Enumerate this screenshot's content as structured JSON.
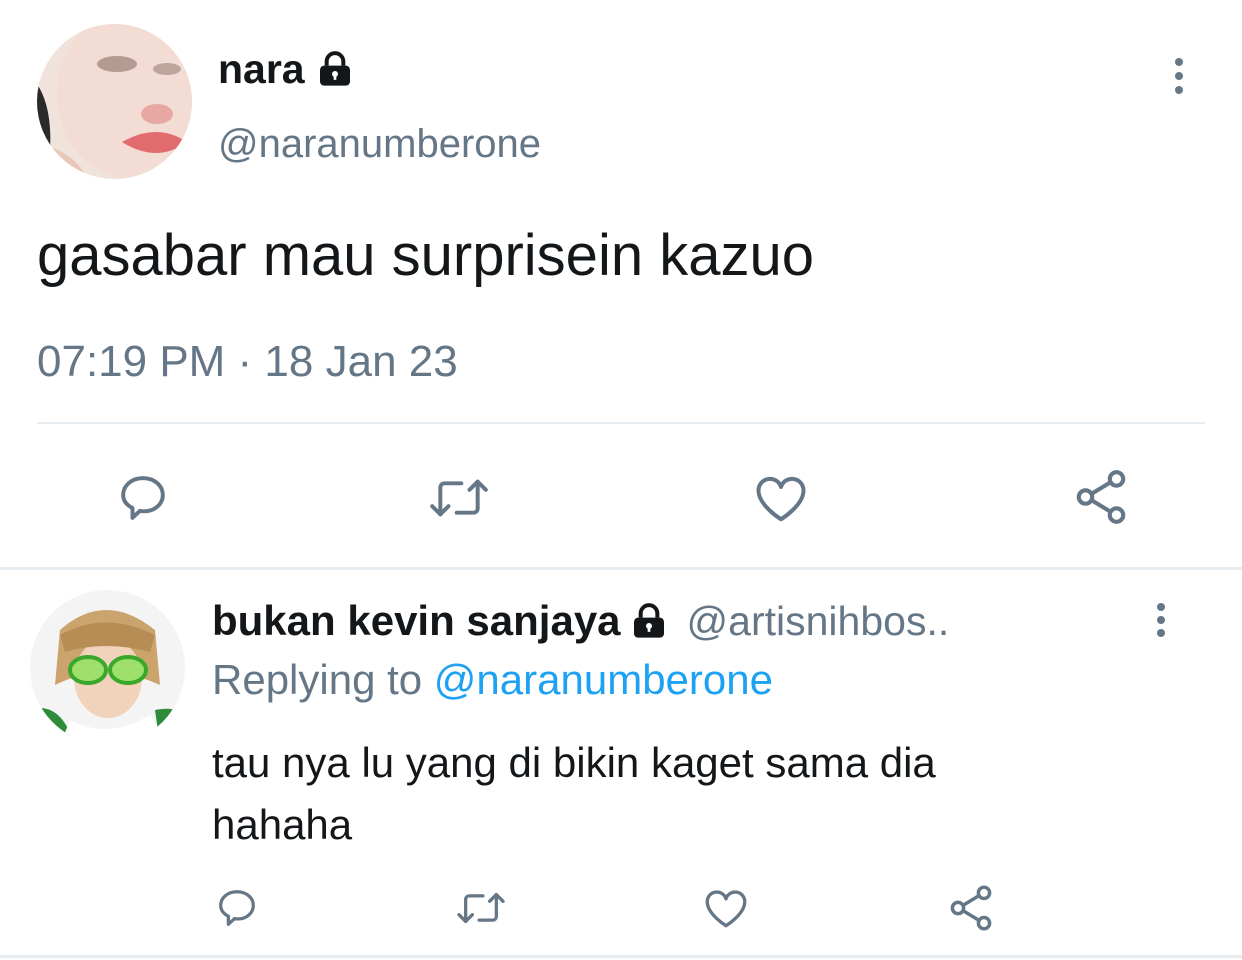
{
  "tweet": {
    "display_name": "nara",
    "handle": "@naranumberone",
    "text": "gasabar mau surprisein kazuo",
    "timestamp": "07:19 PM · 18 Jan 23",
    "avatar_icon": "avatar-photo",
    "protected_icon": "lock-icon",
    "actions": [
      "reply-icon",
      "retweet-icon",
      "like-icon",
      "share-icon"
    ]
  },
  "reply": {
    "display_name": "bukan kevin sanjaya",
    "handle": "@artisnihbos..",
    "replying_to_label": "Replying to",
    "replying_to_handle": "@naranumberone",
    "text_line1": "tau nya lu yang di bikin kaget sama dia",
    "text_line2": "hahaha",
    "avatar_icon": "avatar-photo",
    "protected_icon": "lock-icon",
    "actions": [
      "reply-icon",
      "retweet-icon",
      "like-icon",
      "share-icon"
    ]
  },
  "colors": {
    "text": "#14171a",
    "secondary": "#657786",
    "link": "#1da1f2",
    "divider": "#e6ecf0"
  }
}
